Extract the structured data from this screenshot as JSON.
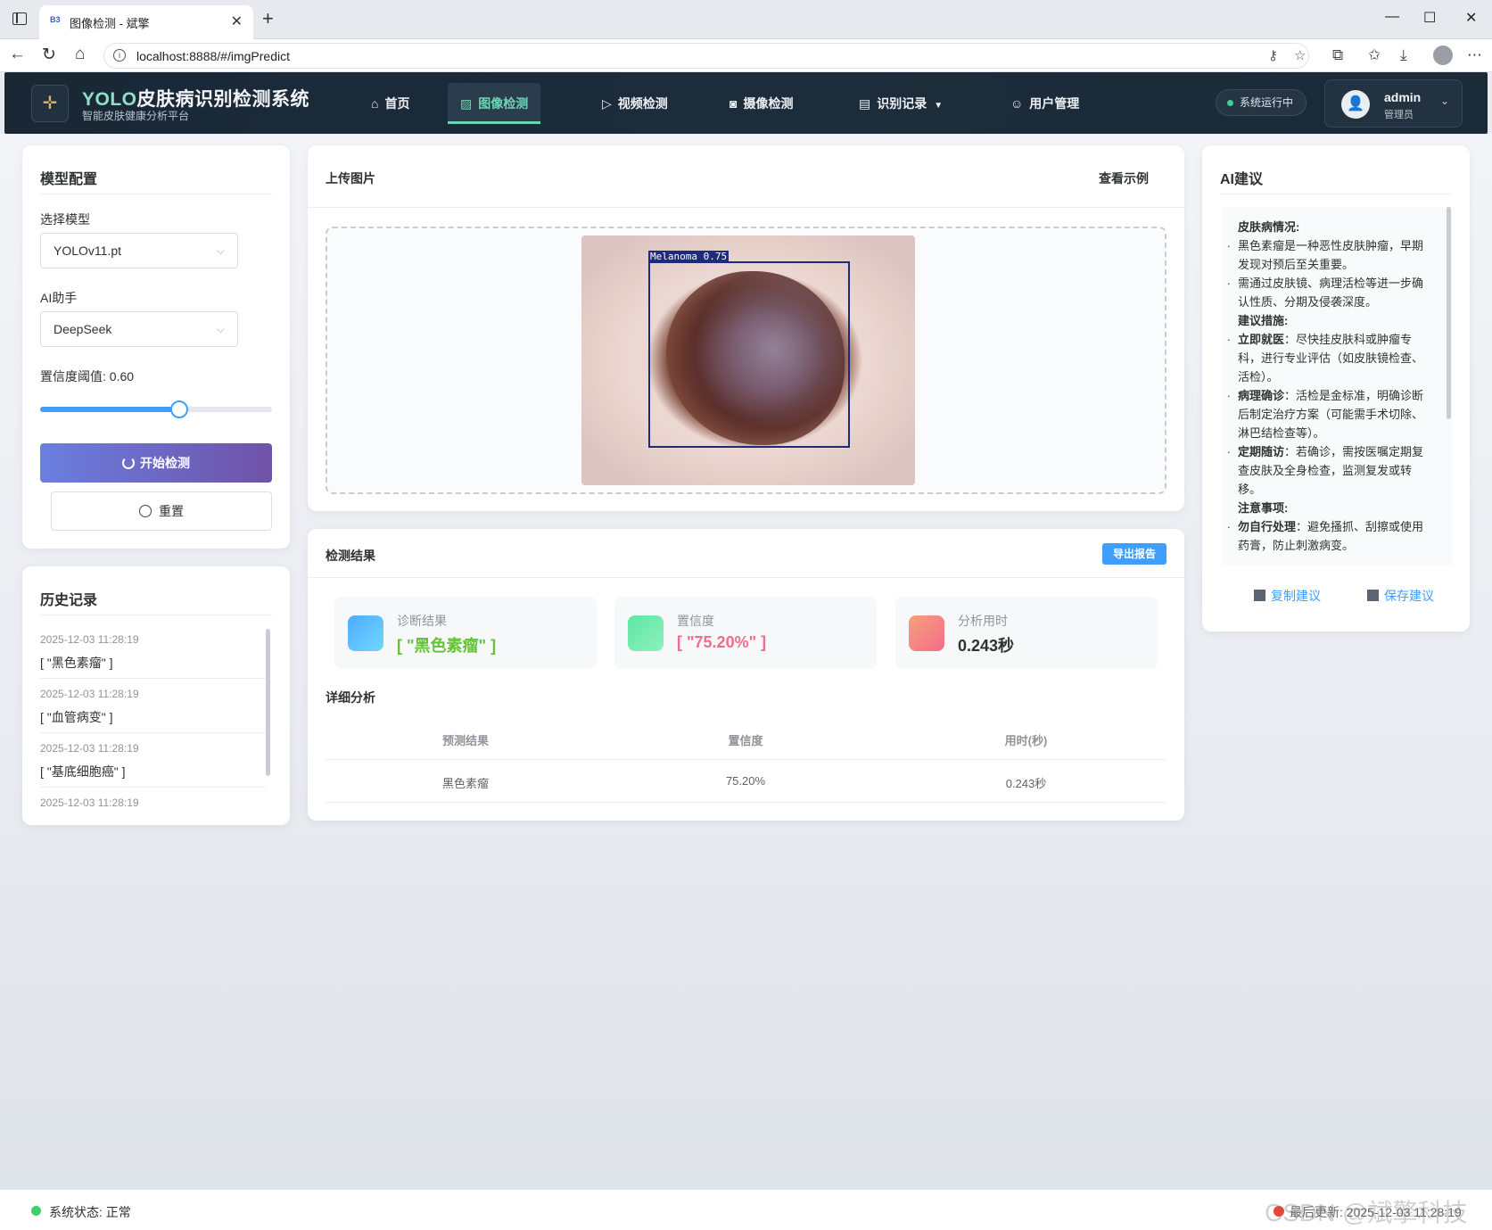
{
  "browser": {
    "tab_title": "图像检测 - 斌擎",
    "url": "localhost:8888/#/imgPredict"
  },
  "header": {
    "title_prefix": "YOLO",
    "title_main": "皮肤病识别检测系统",
    "subtitle": "智能皮肤健康分析平台",
    "nav": [
      {
        "label": "首页",
        "icon": "home-icon"
      },
      {
        "label": "图像检测",
        "icon": "image-icon"
      },
      {
        "label": "视频检测",
        "icon": "play-circle-icon"
      },
      {
        "label": "摄像检测",
        "icon": "camera-icon"
      },
      {
        "label": "识别记录",
        "icon": "document-icon"
      },
      {
        "label": "用户管理",
        "icon": "user-icon"
      }
    ],
    "active_nav": "图像检测",
    "status": "系统运行中",
    "user": {
      "name": "admin",
      "role": "管理员"
    }
  },
  "model_config": {
    "title": "模型配置",
    "model_label": "选择模型",
    "model_value": "YOLOv11.pt",
    "ai_label": "AI助手",
    "ai_value": "DeepSeek",
    "confidence_label": "置信度阈值: 0.60",
    "confidence_value": 0.6,
    "start_button": "开始检测",
    "reset_button": "重置"
  },
  "history": {
    "title": "历史记录",
    "items": [
      {
        "time": "2025-12-03 11:28:19",
        "value": "[ \"黑色素瘤\" ]"
      },
      {
        "time": "2025-12-03 11:28:19",
        "value": "[ \"血管病变\" ]"
      },
      {
        "time": "2025-12-03 11:28:19",
        "value": "[ \"基底细胞癌\" ]"
      },
      {
        "time": "2025-12-03 11:28:19",
        "value": ""
      }
    ]
  },
  "upload": {
    "title": "上传图片",
    "example_link": "查看示例",
    "detection_label": "Melanoma  0.75"
  },
  "results": {
    "title": "检测结果",
    "export_button": "导出报告",
    "stats": [
      {
        "label": "诊断结果",
        "value": "[ \"黑色素瘤\" ]",
        "color": "#67c23a"
      },
      {
        "label": "置信度",
        "value": "[ \"75.20%\" ]",
        "color": "#f56c8a"
      },
      {
        "label": "分析用时",
        "value": "0.243秒",
        "color": "#303133"
      }
    ],
    "detail_title": "详细分析",
    "columns": [
      "预测结果",
      "置信度",
      "用时(秒)"
    ],
    "rows": [
      [
        "黑色素瘤",
        "75.20%",
        "0.243秒"
      ]
    ]
  },
  "ai_advice": {
    "title": "AI建议",
    "lines": [
      {
        "bold": "皮肤病情况:",
        "text": ""
      },
      {
        "bold": "",
        "text": "黑色素瘤是一种恶性皮肤肿瘤，早期"
      },
      {
        "bold": "",
        "text": "发现对预后至关重要。"
      },
      {
        "bold": "",
        "text": "需通过皮肤镜、病理活检等进一步确"
      },
      {
        "bold": "",
        "text": "认性质、分期及侵袭深度。"
      },
      {
        "bold": "建议措施:",
        "text": ""
      },
      {
        "bold": "立即就医",
        "text": "：尽快挂皮肤科或肿瘤专"
      },
      {
        "bold": "",
        "text": "科，进行专业评估（如皮肤镜检查、"
      },
      {
        "bold": "",
        "text": "活检）。"
      },
      {
        "bold": "病理确诊",
        "text": "：活检是金标准，明确诊断"
      },
      {
        "bold": "",
        "text": "后制定治疗方案（可能需手术切除、"
      },
      {
        "bold": "",
        "text": "淋巴结检查等）。"
      },
      {
        "bold": "定期随访",
        "text": "：若确诊，需按医嘱定期复"
      },
      {
        "bold": "",
        "text": "查皮肤及全身检查，监测复发或转"
      },
      {
        "bold": "",
        "text": "移。"
      },
      {
        "bold": "注意事项:",
        "text": ""
      },
      {
        "bold": "勿自行处理",
        "text": "：避免搔抓、刮擦或使用"
      },
      {
        "bold": "",
        "text": "药膏，防止刺激病变。"
      }
    ],
    "copy_button": "复制建议",
    "save_button": "保存建议"
  },
  "footer": {
    "status": "系统状态: 正常",
    "last_update": "最后更新: 2025-12-03 11:28:19",
    "watermark": "CSDN @斌擎科技"
  }
}
